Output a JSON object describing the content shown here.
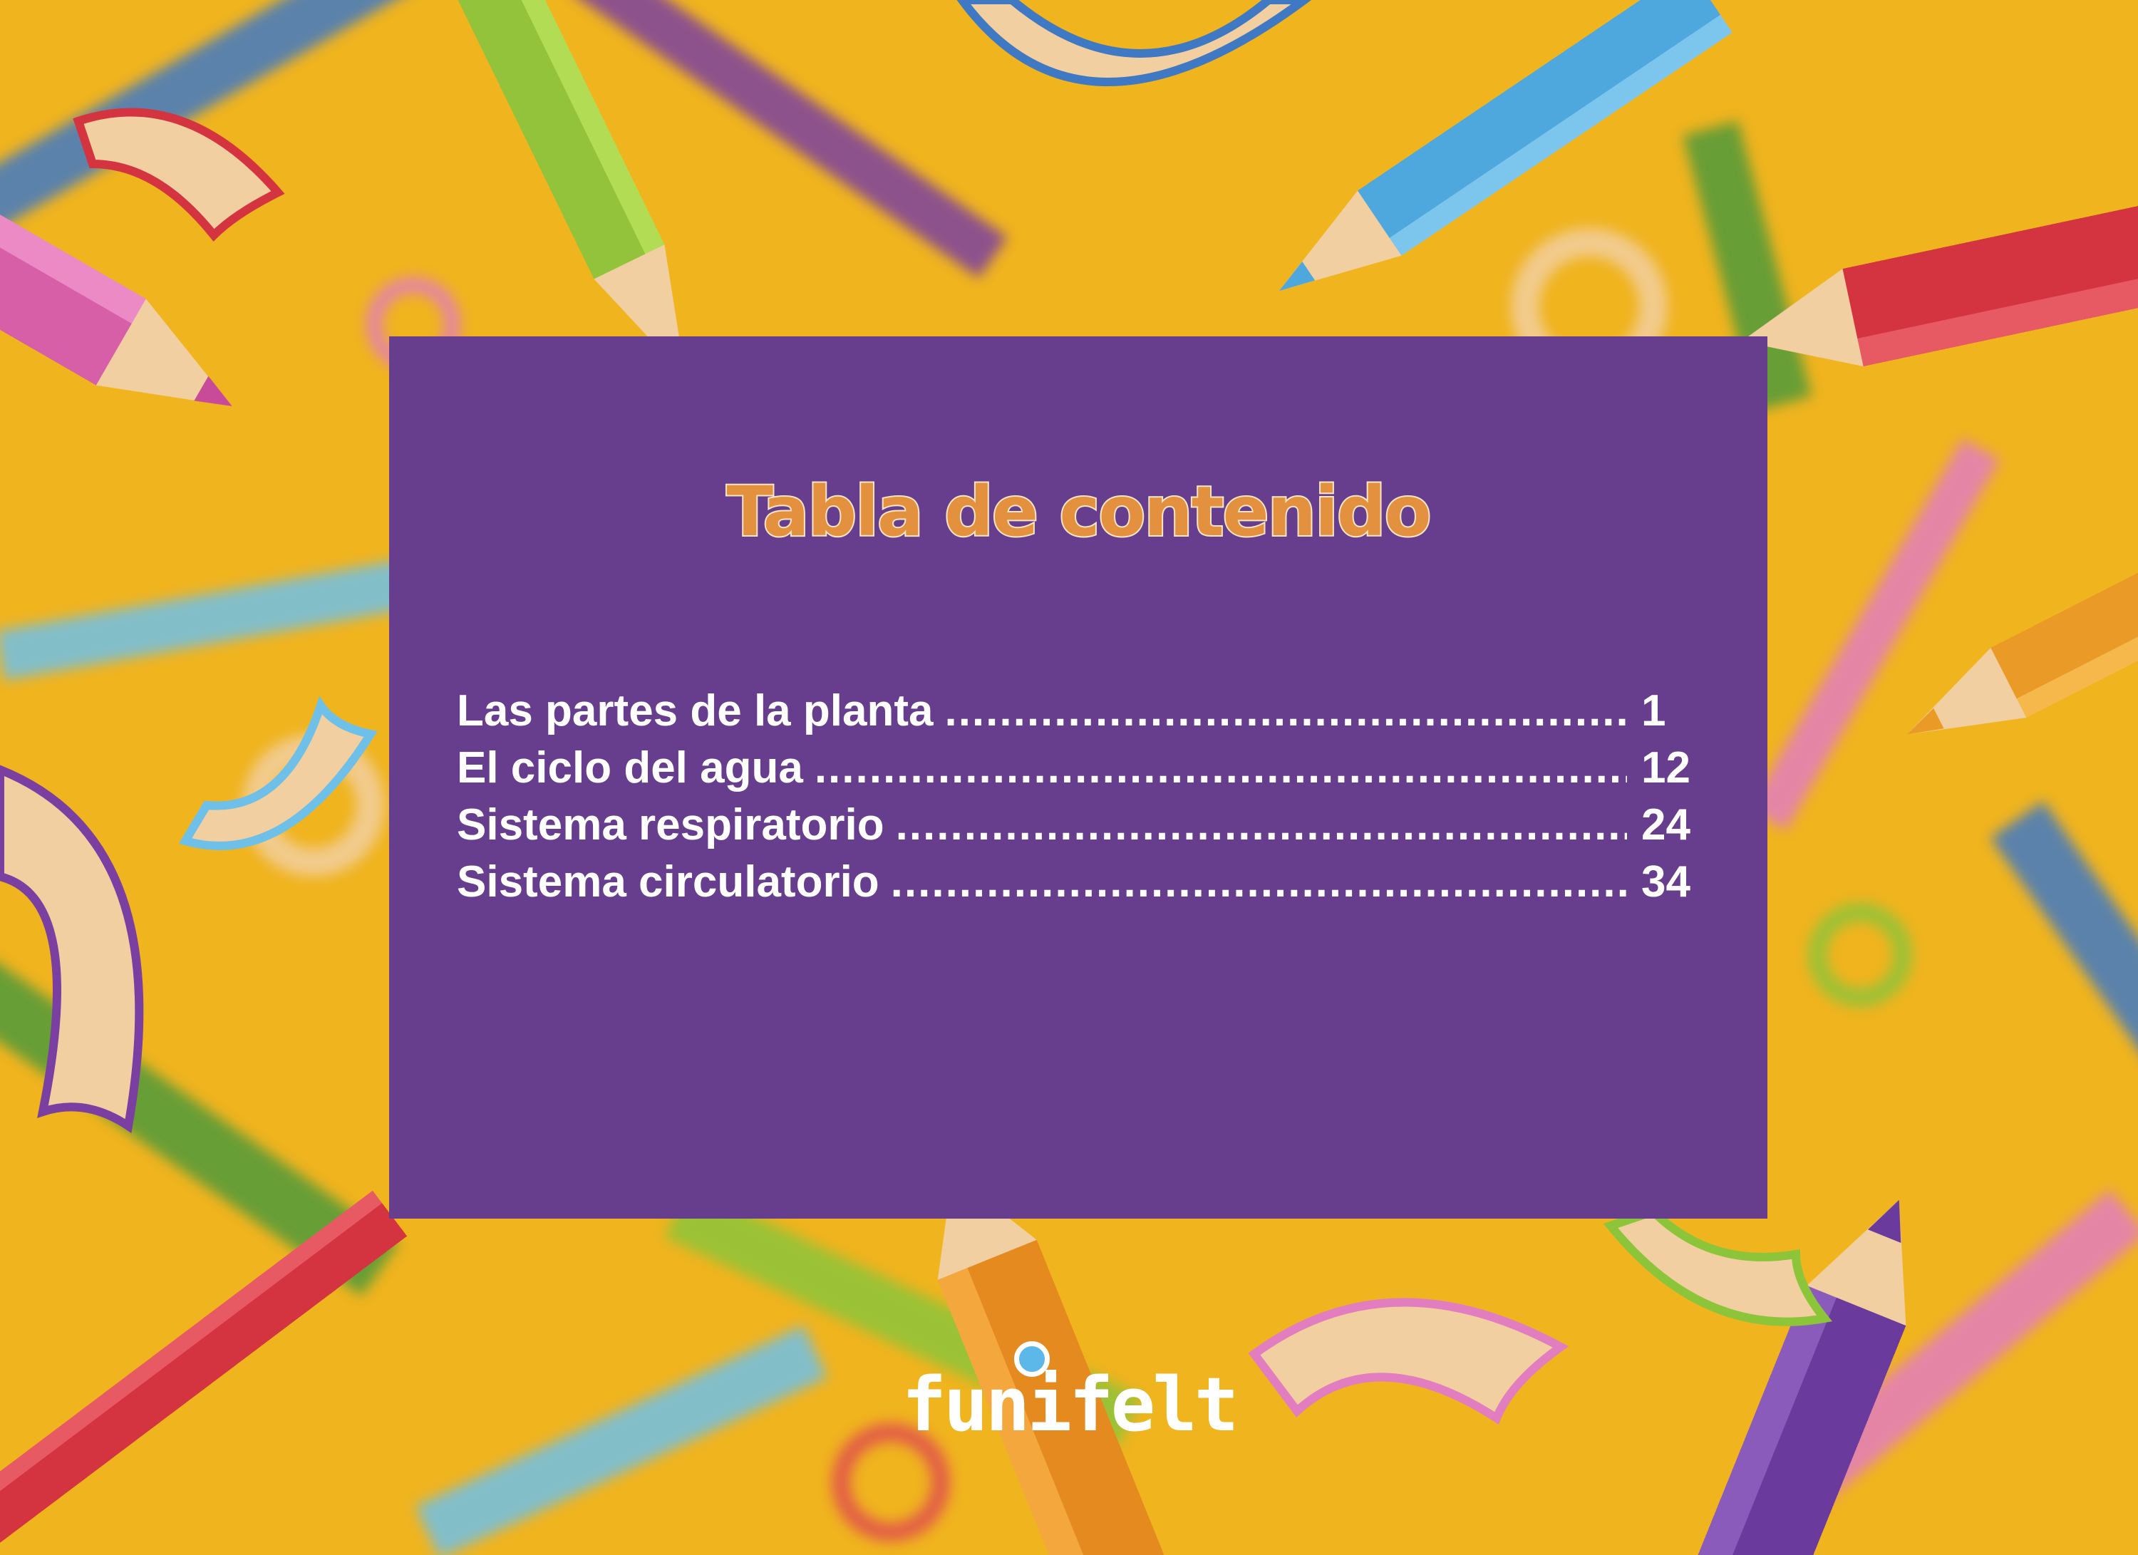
{
  "colors": {
    "background": "#f0b41f",
    "panel": "#673d8d",
    "title": "#e3913f",
    "title_outline": "#fce6c4",
    "entry_text": "#ffffff"
  },
  "toc": {
    "title": "Tabla de contenido",
    "entries": [
      {
        "label": "Las partes de la planta",
        "page": "1"
      },
      {
        "label": "El ciclo del agua",
        "page": "12"
      },
      {
        "label": "Sistema respiratorio",
        "page": "24"
      },
      {
        "label": "Sistema circulatorio",
        "page": "34"
      }
    ]
  },
  "logo": {
    "text": "funifelt",
    "icon": "bubble-icon"
  }
}
